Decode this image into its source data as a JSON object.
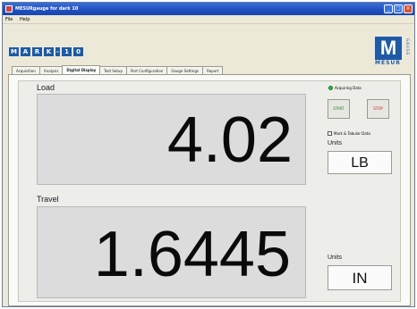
{
  "window": {
    "title": "MESURgauge for dark 10"
  },
  "menu": [
    "File",
    "Help"
  ],
  "brand": {
    "letters": [
      "M",
      "A",
      "R",
      "K",
      "-",
      "1",
      "0"
    ],
    "logo_letter": "M",
    "logo_text": "MESUR",
    "logo_side": "GAUGE"
  },
  "tabs": [
    {
      "label": "Acquisition",
      "active": false
    },
    {
      "label": "Analysis",
      "active": false
    },
    {
      "label": "Digital Display",
      "active": true
    },
    {
      "label": "Test Setup",
      "active": false
    },
    {
      "label": "Port Configuration",
      "active": false
    },
    {
      "label": "Gauge Settings",
      "active": false
    },
    {
      "label": "Report",
      "active": false
    }
  ],
  "load": {
    "label": "Load",
    "value": "4.02",
    "units_label": "Units",
    "units": "LB"
  },
  "travel": {
    "label": "Travel",
    "value": "1.6445",
    "units_label": "Units",
    "units": "IN"
  },
  "status": {
    "text": "Acquiring Data",
    "led_color": "#2fb52f"
  },
  "buttons": {
    "start": "START",
    "stop": "STOP"
  },
  "checkbox": {
    "label": "Mark & Tabular Data",
    "checked": false
  }
}
